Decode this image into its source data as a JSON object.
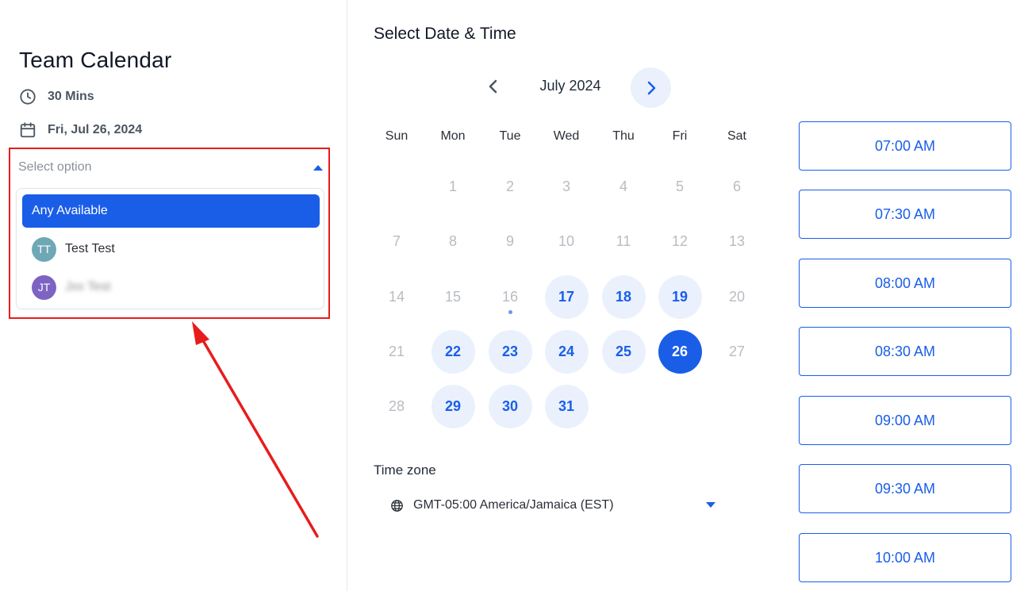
{
  "event": {
    "title": "Team Calendar",
    "duration": "30 Mins",
    "date": "Fri, Jul 26, 2024"
  },
  "member_select": {
    "placeholder": "Select option",
    "options": [
      {
        "label": "Any Available",
        "selected": true
      },
      {
        "label": "Test Test",
        "initials": "TT",
        "avatar_color": "#6fa8b5"
      },
      {
        "label": "Jxx Test",
        "initials": "JT",
        "avatar_color": "#7d63c2"
      }
    ]
  },
  "calendar": {
    "section_title": "Select Date & Time",
    "month_label": "July 2024",
    "weekdays": [
      "Sun",
      "Mon",
      "Tue",
      "Wed",
      "Thu",
      "Fri",
      "Sat"
    ],
    "days": [
      {
        "n": "1"
      },
      {
        "n": "2"
      },
      {
        "n": "3"
      },
      {
        "n": "4"
      },
      {
        "n": "5"
      },
      {
        "n": "6"
      },
      {
        "n": "7"
      },
      {
        "n": "8"
      },
      {
        "n": "9"
      },
      {
        "n": "10"
      },
      {
        "n": "11"
      },
      {
        "n": "12"
      },
      {
        "n": "13"
      },
      {
        "n": "14"
      },
      {
        "n": "15"
      },
      {
        "n": "16",
        "today": true
      },
      {
        "n": "17",
        "available": true
      },
      {
        "n": "18",
        "available": true
      },
      {
        "n": "19",
        "available": true
      },
      {
        "n": "20"
      },
      {
        "n": "21"
      },
      {
        "n": "22",
        "available": true
      },
      {
        "n": "23",
        "available": true
      },
      {
        "n": "24",
        "available": true
      },
      {
        "n": "25",
        "available": true
      },
      {
        "n": "26",
        "selected": true
      },
      {
        "n": "27"
      },
      {
        "n": "28"
      },
      {
        "n": "29",
        "available": true
      },
      {
        "n": "30",
        "available": true
      },
      {
        "n": "31",
        "available": true
      }
    ],
    "accent_color": "#1a5ee8"
  },
  "timezone": {
    "label": "Time zone",
    "value": "GMT-05:00 America/Jamaica (EST)"
  },
  "time_slots": [
    "07:00 AM",
    "07:30 AM",
    "08:00 AM",
    "08:30 AM",
    "09:00 AM",
    "09:30 AM",
    "10:00 AM"
  ]
}
